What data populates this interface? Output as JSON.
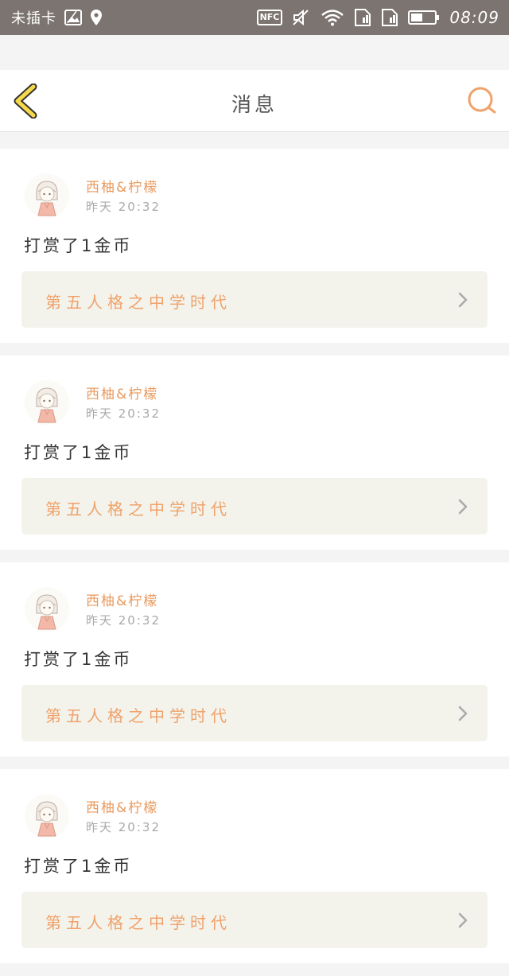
{
  "status_bar": {
    "carrier": "未插卡",
    "nfc_label": "NFC",
    "time": "08:09"
  },
  "header": {
    "title": "消息",
    "back_icon": "chevron-left-icon",
    "search_icon": "search-icon"
  },
  "colors": {
    "accent": "#f0a26a",
    "back_icon": "#f5d94a",
    "status_bar": "#7c7470",
    "card_link_bg": "#f3f3ec"
  },
  "messages": [
    {
      "sender": "西柚&柠檬",
      "time": "昨天 20:32",
      "text": "打赏了1金币",
      "post_title": "第五人格之中学时代"
    },
    {
      "sender": "西柚&柠檬",
      "time": "昨天 20:32",
      "text": "打赏了1金币",
      "post_title": "第五人格之中学时代"
    },
    {
      "sender": "西柚&柠檬",
      "time": "昨天 20:32",
      "text": "打赏了1金币",
      "post_title": "第五人格之中学时代"
    },
    {
      "sender": "西柚&柠檬",
      "time": "昨天 20:32",
      "text": "打赏了1金币",
      "post_title": "第五人格之中学时代"
    }
  ]
}
